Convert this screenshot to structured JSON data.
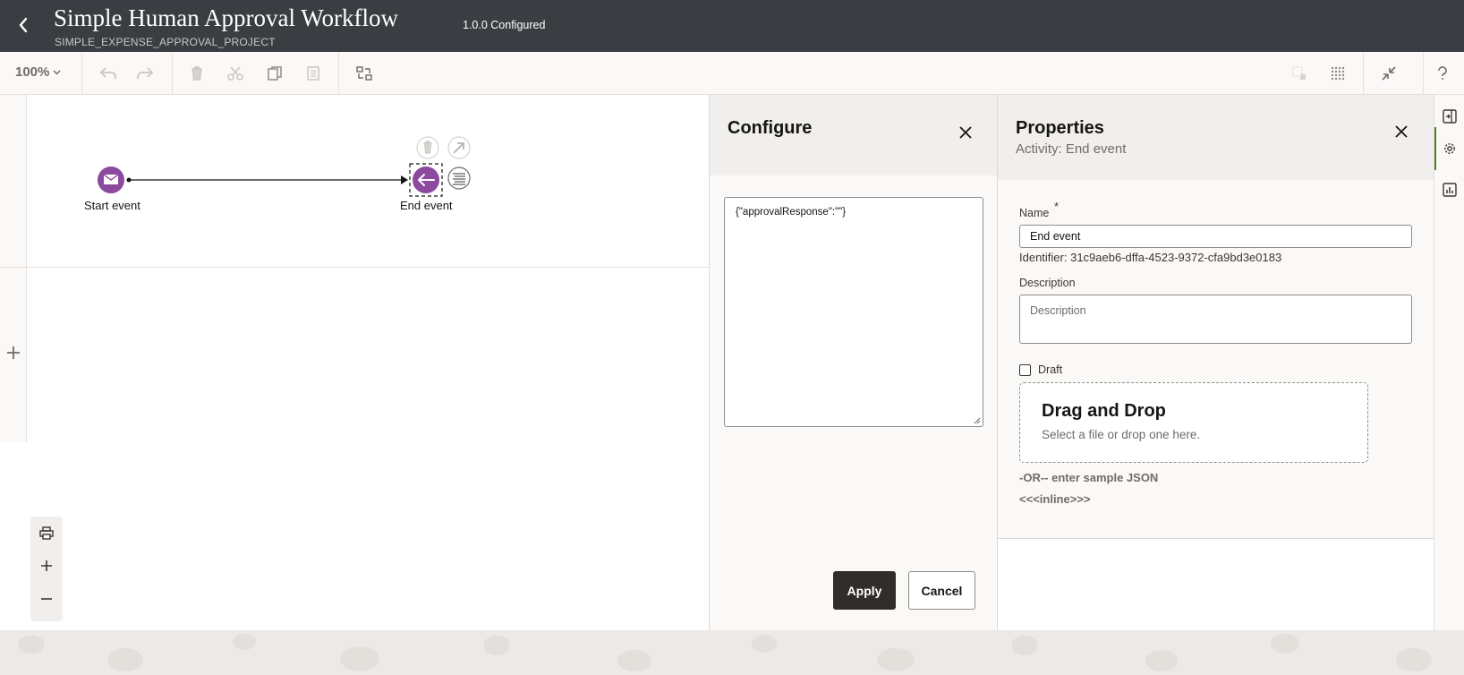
{
  "header": {
    "title": "Simple Human Approval Workflow",
    "subtitle": "SIMPLE_EXPENSE_APPROVAL_PROJECT",
    "version": "1.0.0 Configured",
    "back_icon": "chevron-left-icon"
  },
  "toolbar": {
    "zoom": "100%",
    "icons": [
      "undo-icon",
      "redo-icon",
      "delete-icon",
      "cut-icon",
      "copy-icon",
      "paste-icon",
      "layout-icon",
      "lock-icon",
      "grid-icon",
      "collapse-icon",
      "help-icon"
    ]
  },
  "canvas": {
    "nodes": [
      {
        "label": "Start event",
        "type": "message-start"
      },
      {
        "label": "End event",
        "type": "end",
        "selected": true
      }
    ],
    "zoom_controls": [
      "print-icon",
      "zoom-in-icon",
      "zoom-out-icon"
    ]
  },
  "configure": {
    "title": "Configure",
    "json_value": "{\"approvalResponse\":\"\"}",
    "apply_label": "Apply",
    "cancel_label": "Cancel"
  },
  "properties": {
    "title": "Properties",
    "subtitle": "Activity: End event",
    "name_label": "Name",
    "name_required": "*",
    "name_value": "End event",
    "identifier": "Identifier: 31c9aeb6-dffa-4523-9372-cfa9bd3e0183",
    "description_label": "Description",
    "description_placeholder": "Description",
    "draft_label": "Draft",
    "draft_checked": false,
    "drop_title": "Drag and Drop",
    "drop_subtitle": "Select a file or drop one here.",
    "or_text": "-OR-- enter sample JSON",
    "inline_text": "<<<inline>>>"
  },
  "rail": {
    "icons": [
      "panel-icon",
      "gear-icon",
      "chart-icon"
    ],
    "active": "gear-icon"
  },
  "colors": {
    "header_bg": "#3a3e43",
    "event_purple": "#8b4a9e",
    "primary_button": "#312d2a",
    "active_green": "#508223"
  }
}
